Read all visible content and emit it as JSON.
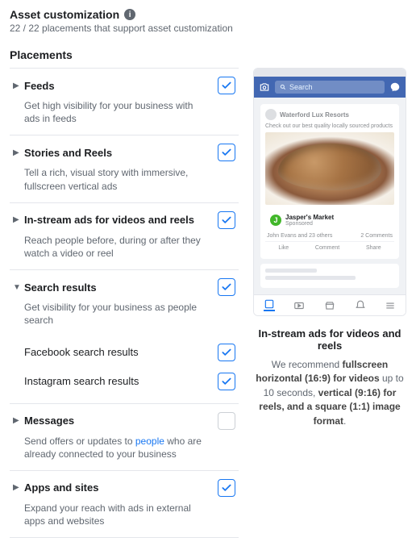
{
  "header": {
    "title": "Asset customization",
    "subtext": "22 / 22 placements that support asset customization"
  },
  "section_title": "Placements",
  "placements": [
    {
      "label": "Feeds",
      "desc": "Get high visibility for your business with ads in feeds",
      "expanded": false,
      "checked": true
    },
    {
      "label": "Stories and Reels",
      "desc": "Tell a rich, visual story with immersive, fullscreen vertical ads",
      "expanded": false,
      "checked": true
    },
    {
      "label": "In-stream ads for videos and reels",
      "desc": "Reach people before, during or after they watch a video or reel",
      "expanded": false,
      "checked": true
    },
    {
      "label": "Search results",
      "desc": "Get visibility for your business as people search",
      "expanded": true,
      "checked": true,
      "children": [
        {
          "label": "Facebook search results",
          "checked": true
        },
        {
          "label": "Instagram search results",
          "checked": true
        }
      ]
    },
    {
      "label": "Messages",
      "desc_pre": "Send offers or updates to ",
      "desc_link": "people",
      "desc_post": " who are already connected to your business",
      "expanded": false,
      "checked": false
    },
    {
      "label": "Apps and sites",
      "desc": "Expand your reach with ads in external apps and websites",
      "expanded": false,
      "checked": true
    }
  ],
  "preview": {
    "search_placeholder": "Search",
    "post_name": "Waterford Lux Resorts",
    "post_caption": "Check out our best quality locally sourced products",
    "sponsor_name": "Jasper's Market",
    "sponsor_sub": "Sponsored",
    "engage_left": "John Evans and 23 others",
    "engage_right": "2 Comments",
    "action_like": "Like",
    "action_comment": "Comment",
    "action_share": "Share"
  },
  "recommendation": {
    "title": "In-stream ads for videos and reels",
    "pre": "We recommend ",
    "b1": "fullscreen horizontal (16:9) for videos",
    "mid1": " up to 10 seconds, ",
    "b2": "vertical (9:16) for reels, and a square (1:1) image format",
    "post": "."
  }
}
